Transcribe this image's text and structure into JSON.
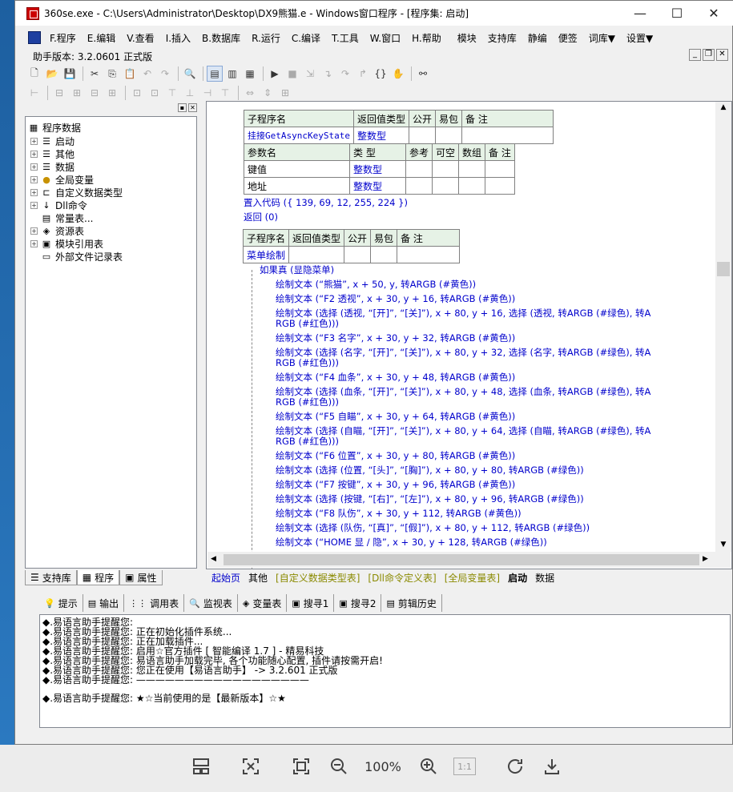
{
  "window": {
    "title": "360se.exe - C:\\Users\\Administrator\\Desktop\\DX9熊猫.e - Windows窗口程序 - [程序集: 启动]",
    "min": "—",
    "max": "☐",
    "close": "✕"
  },
  "menu": [
    "F.程序",
    "E.编辑",
    "V.查看",
    "I.插入",
    "B.数据库",
    "R.运行",
    "C.编译",
    "T.工具",
    "W.窗口",
    "H.帮助",
    "模块",
    "支持库",
    "静编",
    "便签",
    "词库▼",
    "设置▼"
  ],
  "version": "助手版本: 3.2.0601 正式版",
  "tree": {
    "root": "程序数据",
    "items": [
      "启动",
      "其他",
      "数据",
      "全局变量",
      "自定义数据类型",
      "Dll命令",
      "常量表...",
      "资源表",
      "模块引用表",
      "外部文件记录表"
    ]
  },
  "left_tabs": [
    "支持库",
    "程序",
    "属性"
  ],
  "sub1": {
    "headers": [
      "子程序名",
      "返回值类型",
      "公开",
      "易包",
      "备 注"
    ],
    "name": "挂接GetAsyncKeyState",
    "ret": "整数型",
    "param_headers": [
      "参数名",
      "类 型",
      "参考",
      "可空",
      "数组",
      "备 注"
    ],
    "params": [
      [
        "键值",
        "整数型"
      ],
      [
        "地址",
        "整数型"
      ]
    ]
  },
  "code1": [
    "置入代码 ({ 139, 69, 12, 255, 224 })",
    "返回 (0)"
  ],
  "sub2": {
    "headers": [
      "子程序名",
      "返回值类型",
      "公开",
      "易包",
      "备 注"
    ],
    "name": "菜单绘制"
  },
  "code2": [
    "如果真 (显隐菜单)",
    "绘制文本 (“熊猫”, x + 50, y, 转ARGB (#黄色))",
    "绘制文本 (“F2 透视”, x + 30, y + 16, 转ARGB (#黄色))",
    "绘制文本 (选择 (透视, “[开]”, “[关]”), x + 80, y + 16, 选择 (透视, 转ARGB (#绿色), 转A",
    "RGB (#红色)))",
    "绘制文本 (“F3 名字”, x + 30, y + 32, 转ARGB (#黄色))",
    "绘制文本 (选择 (名字, “[开]”, “[关]”), x + 80, y + 32, 选择 (名字, 转ARGB (#绿色), 转A",
    "RGB (#红色)))",
    "绘制文本 (“F4 血条”, x + 30, y + 48, 转ARGB (#黄色))",
    "绘制文本 (选择 (血条, “[开]”, “[关]”), x + 80, y + 48, 选择 (血条, 转ARGB (#绿色), 转A",
    "RGB (#红色)))",
    "绘制文本 (“F5 自瞄”, x + 30, y + 64, 转ARGB (#黄色))",
    "绘制文本 (选择 (自瞄, “[开]”, “[关]”), x + 80, y + 64, 选择 (自瞄, 转ARGB (#绿色), 转A",
    "RGB (#红色)))",
    "绘制文本 (“F6 位置”, x + 30, y + 80, 转ARGB (#黄色))",
    "绘制文本 (选择 (位置, “[头]”, “[胸]”), x + 80, y + 80, 转ARGB (#绿色))",
    "绘制文本 (“F7 按键”, x + 30, y + 96, 转ARGB (#黄色))",
    "绘制文本 (选择 (按键, “[右]”, “[左]”), x + 80, y + 96, 转ARGB (#绿色))",
    "绘制文本 (“F8 队伤”, x + 30, y + 112, 转ARGB (#黄色))",
    "绘制文本 (选择 (队伤, “[真]”, “[假]”), x + 80, y + 112, 转ARGB (#绿色))",
    "绘制文本 (“HOME 显 / 隐”, x + 30, y + 128, 转ARGB (#绿色))"
  ],
  "editor_tabs": [
    "起始页",
    "其他",
    "[自定义数据类型表]",
    "[Dll命令定义表]",
    "[全局变量表]",
    "启动",
    "数据"
  ],
  "bottom_tabs": [
    "提示",
    "输出",
    "调用表",
    "监视表",
    "变量表",
    "搜寻1",
    "搜寻2",
    "剪辑历史"
  ],
  "output_lines": [
    "◆.易语言助手提醒您:",
    "◆.易语言助手提醒您: 正在初始化插件系统...",
    "◆.易语言助手提醒您: 正在加载插件...",
    "◆.易语言助手提醒您: 启用☆官方插件 [ 智能编译 1.7 ] - 精易科技",
    "◆.易语言助手提醒您: 易语言助手加载完毕, 各个功能随心配置, 插件请按需开启!",
    "◆.易语言助手提醒您: 您正在使用【易语言助手】 -> 3.2.601 正式版",
    "◆.易语言助手提醒您: ——————————————————",
    "◆.易语言助手提醒您: ★☆当前使用的是【最新版本】☆★"
  ],
  "viewer": {
    "zoom": "100%",
    "ratio": "1:1"
  }
}
